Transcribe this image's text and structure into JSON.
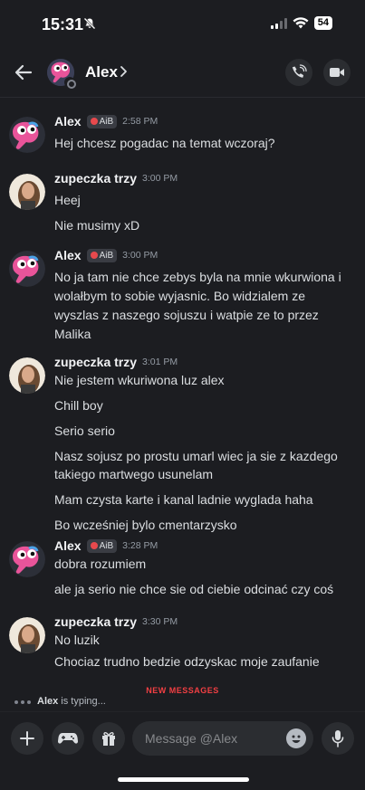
{
  "status_bar": {
    "time": "15:31",
    "battery": "54"
  },
  "header": {
    "name": "Alex",
    "chevron": "›"
  },
  "icons": {
    "back": "arrow-left-icon",
    "call": "phone-icon",
    "video": "video-camera-icon",
    "add": "plus-icon",
    "games": "gamepad-icon",
    "gift": "gift-icon",
    "emoji": "emoji-icon",
    "mic": "microphone-icon",
    "mute": "bell-slash-icon"
  },
  "colors": {
    "background": "#1c1d21",
    "accent_red": "#f23f43",
    "tag_bg": "#3a3c43"
  },
  "messages": [
    {
      "author": "Alex",
      "tag": "AiB",
      "time": "2:58 PM",
      "lines": [
        "Hej chcesz pogadac na temat wczoraj?"
      ]
    },
    {
      "author": "zupeczka trzy",
      "time": "3:00 PM",
      "lines": [
        "Heej",
        "Nie musimy xD"
      ]
    },
    {
      "author": "Alex",
      "tag": "AiB",
      "time": "3:00 PM",
      "lines": [
        "No ja tam nie chce zebys byla na mnie wkurwiona i",
        "wolałbym to sobie wyjasnic. Bo widzialem ze",
        "wyszlas z naszego sojuszu i watpie ze to przez",
        "Malika"
      ]
    },
    {
      "author": "zupeczka trzy",
      "time": "3:01 PM",
      "lines": [
        "Nie jestem wkuriwona luz alex",
        "Chill boy",
        "Serio serio",
        "Nasz sojusz po prostu umarl wiec ja sie z kazdego",
        "takiego martwego usunelam",
        "Mam czysta karte i kanal ladnie wyglada haha",
        "Bo wcześniej bylo cmentarzysko"
      ]
    },
    {
      "author": "Alex",
      "tag": "AiB",
      "time": "3:28 PM",
      "lines": [
        "dobra rozumiem",
        "ale ja serio nie chce sie od ciebie odcinać czy coś"
      ]
    },
    {
      "author": "zupeczka trzy",
      "time": "3:30 PM",
      "lines": [
        "No luzik",
        "Chociaz trudno bedzie odzyskac moje zaufanie"
      ]
    }
  ],
  "new_messages_label": "NEW MESSAGES",
  "typing": {
    "name": "Alex",
    "text": " is typing..."
  },
  "composer": {
    "placeholder": "Message @Alex"
  }
}
